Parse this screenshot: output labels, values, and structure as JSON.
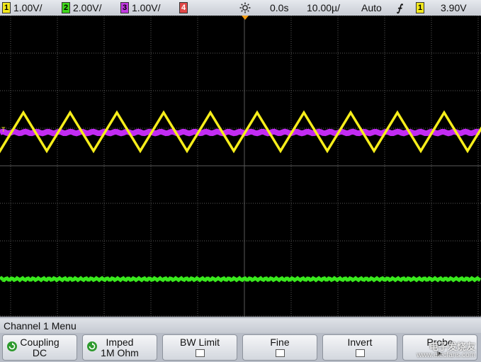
{
  "status": {
    "channels": [
      {
        "num": "1",
        "scale": "1.00V/",
        "color": "#f2e81c"
      },
      {
        "num": "2",
        "scale": "2.00V/",
        "color": "#3fd61c"
      },
      {
        "num": "3",
        "scale": "1.00V/",
        "color": "#c13ae0"
      },
      {
        "num": "4",
        "scale": "",
        "color": "#e04848"
      }
    ],
    "delay": "0.0s",
    "timebase": "10.00µ/",
    "trigger_mode": "Auto",
    "trigger_channel": "1",
    "trigger_level": "3.90V",
    "icons": [
      "sun-icon",
      "rising-edge-icon"
    ]
  },
  "display": {
    "background": "#000000",
    "grid_color": "#5a5a5a",
    "traces": [
      {
        "name": "1",
        "shape": "triangle",
        "color": "#f7ee1a"
      },
      {
        "name": "3",
        "shape": "flat-noise",
        "color": "#c22cf2"
      },
      {
        "name": "2",
        "shape": "flat-noise",
        "color": "#39e81d"
      }
    ],
    "markers": [
      {
        "label": "T",
        "color": "#f2e81c"
      },
      {
        "label": "1",
        "color": "#3fd61c"
      }
    ]
  },
  "menu": {
    "title": "Channel 1  Menu",
    "softkeys": [
      {
        "label": "Coupling",
        "value": "DC",
        "icon": "rotate-icon"
      },
      {
        "label": "Imped",
        "value": "1M Ohm",
        "icon": "rotate-icon"
      },
      {
        "label": "BW Limit",
        "value": "",
        "checkbox": true
      },
      {
        "label": "Fine",
        "value": "",
        "checkbox": true
      },
      {
        "label": "Invert",
        "value": "",
        "checkbox": true
      },
      {
        "label": "Probe",
        "value": "",
        "icon": "arrow-icon"
      }
    ]
  },
  "watermark": {
    "text": "电子发烧友",
    "subtext": "www.elecfans.com"
  }
}
